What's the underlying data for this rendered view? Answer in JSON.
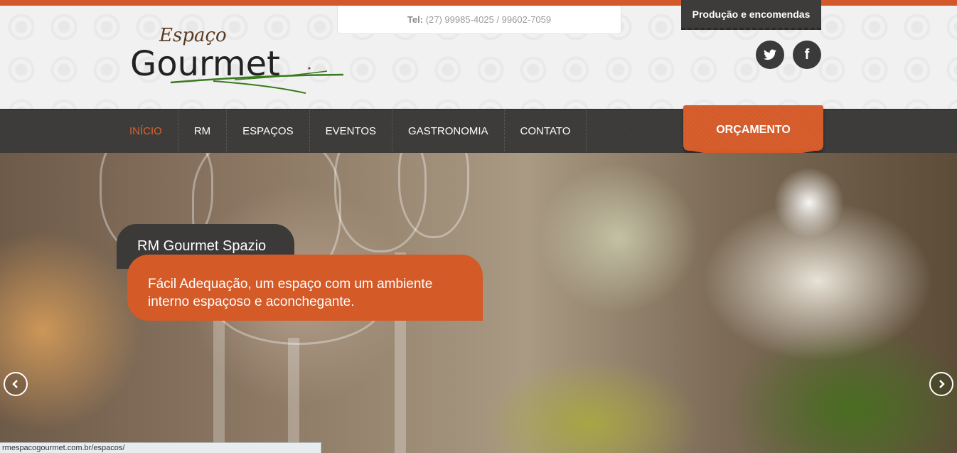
{
  "header": {
    "phone_label": "Tel:",
    "phone_numbers": "(27) 99985-4025 / 99602-7059",
    "ribbon": "Produção e encomendas",
    "logo_top": "Espaço",
    "logo_main": "Gourmet",
    "social": [
      {
        "icon": "twitter-icon"
      },
      {
        "icon": "facebook-icon",
        "glyph": "f"
      }
    ]
  },
  "nav": {
    "items": [
      {
        "label": "INÍCIO",
        "active": true
      },
      {
        "label": "RM"
      },
      {
        "label": "ESPAÇOS"
      },
      {
        "label": "EVENTOS"
      },
      {
        "label": "GASTRONOMIA"
      },
      {
        "label": "CONTATO"
      }
    ],
    "cta": "ORÇAMENTO"
  },
  "hero": {
    "title": "RM Gourmet Spazio",
    "text": "Fácil Adequação, um espaço com um ambiente interno espaçoso e aconchegante."
  },
  "status_bar": {
    "url": "rmespacogourmet.com.br/espacos/"
  },
  "colors": {
    "accent": "#d45a28",
    "dark": "#3b3a39",
    "logo_green": "#3a7a1e",
    "logo_brown": "#5a3a22"
  }
}
